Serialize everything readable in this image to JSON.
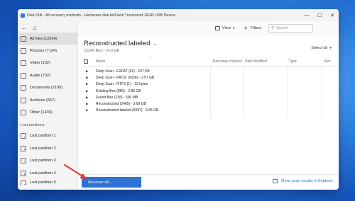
{
  "window": {
    "title": "Disk Drill - All recovery methods - Hardware disk ArtFlash Transcend 16GB USB Device",
    "controls": {
      "minimize": "—",
      "maximize": "☐",
      "close": "✕"
    }
  },
  "nav": {
    "back": "←",
    "home": "⌂"
  },
  "sidebar": {
    "items": [
      {
        "label": "All files (12249)"
      },
      {
        "label": "Pictures (7124)"
      },
      {
        "label": "Video (132)"
      },
      {
        "label": "Audio (702)"
      },
      {
        "label": "Documents (2199)"
      },
      {
        "label": "Archives (657)"
      },
      {
        "label": "Other (1435)"
      }
    ],
    "section_label": "Lost partitions",
    "partitions": [
      {
        "label": "Lost partition 1"
      },
      {
        "label": "Lost partition 2"
      },
      {
        "label": "Lost partition 3"
      },
      {
        "label": "Lost partition 4"
      },
      {
        "label": "Lost partition 5"
      }
    ]
  },
  "toolbar": {
    "view_label": "View",
    "filters_label": "Filters",
    "search_placeholder": "Search"
  },
  "main": {
    "title": "Reconstructed labeled",
    "subtitle": "12249 files / 14.0 GB",
    "select_all": "Select all",
    "columns": {
      "name": "Name",
      "recovery": "Recovery chances",
      "date": "Date Modified",
      "type": "Type",
      "size": "Size"
    },
    "rows": [
      {
        "name": "Deep Scan - EXFAT (52) - 537 KB"
      },
      {
        "name": "Deep Scan - FAT32 (9336) - 2.57 GB"
      },
      {
        "name": "Deep Scan - NTFS (1) - 12 bytes"
      },
      {
        "name": "Existing files (860) - 2.85 GB"
      },
      {
        "name": "Found files (238) - 590 MB"
      },
      {
        "name": "Reconstructed (2465) - 3.69 GB"
      },
      {
        "name": "Reconstructed labeled (6697) - 3.35 GB"
      }
    ]
  },
  "bottom": {
    "recover_label": "Recover all...",
    "explorer_label": "Show scan results in Explorer"
  },
  "colors": {
    "accent": "#2f72d6",
    "arrow": "#e53935"
  }
}
